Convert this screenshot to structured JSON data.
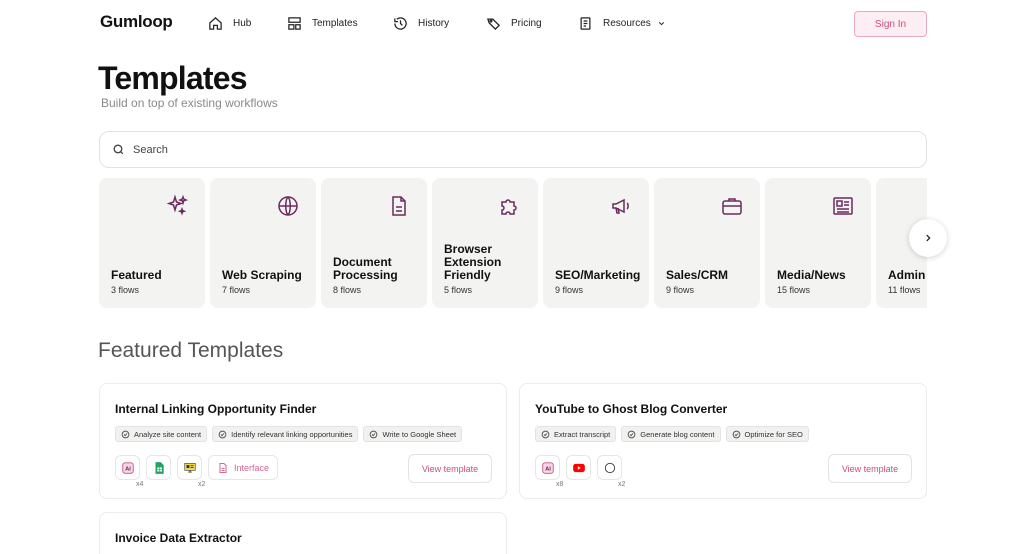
{
  "header": {
    "logo": "Gumloop",
    "nav": [
      {
        "label": "Hub",
        "icon": "home-icon"
      },
      {
        "label": "Templates",
        "icon": "layout-icon"
      },
      {
        "label": "History",
        "icon": "history-icon"
      },
      {
        "label": "Pricing",
        "icon": "tag-icon"
      },
      {
        "label": "Resources",
        "icon": "book-icon"
      }
    ],
    "signin": "Sign In"
  },
  "page": {
    "title": "Templates",
    "subtitle": "Build on top of existing workflows"
  },
  "search": {
    "placeholder": "Search"
  },
  "categories": [
    {
      "name": "Featured",
      "count": "3 flows",
      "icon": "sparkles-icon"
    },
    {
      "name": "Web Scraping",
      "count": "7 flows",
      "icon": "globe-icon"
    },
    {
      "name": "Document Processing",
      "count": "8 flows",
      "icon": "document-icon"
    },
    {
      "name": "Browser Extension Friendly",
      "count": "5 flows",
      "icon": "puzzle-icon"
    },
    {
      "name": "SEO/Marketing",
      "count": "9 flows",
      "icon": "megaphone-icon"
    },
    {
      "name": "Sales/CRM",
      "count": "9 flows",
      "icon": "briefcase-icon"
    },
    {
      "name": "Media/News",
      "count": "15 flows",
      "icon": "newspaper-icon"
    },
    {
      "name": "Admin",
      "count": "11 flows",
      "icon": "admin-icon"
    }
  ],
  "featured": {
    "title": "Featured Templates",
    "cards": [
      {
        "title": "Internal Linking Opportunity Finder",
        "tags": [
          "Analyze site content",
          "Identify relevant linking opportunities",
          "Write to Google Sheet"
        ],
        "nodes": [
          {
            "icon": "ai-icon",
            "count": "x4"
          },
          {
            "icon": "google-sheets-icon",
            "count": ""
          },
          {
            "icon": "scraper-icon",
            "count": "x2"
          }
        ],
        "interface_label": "Interface",
        "button": "View template"
      },
      {
        "title": "YouTube to Ghost Blog Converter",
        "tags": [
          "Extract transcript",
          "Generate blog content",
          "Optimize for SEO"
        ],
        "nodes": [
          {
            "icon": "ai-icon",
            "count": "x8"
          },
          {
            "icon": "youtube-icon",
            "count": ""
          },
          {
            "icon": "ghost-icon",
            "count": "x2"
          }
        ],
        "button": "View template"
      },
      {
        "title": "Invoice Data Extractor"
      }
    ]
  },
  "colors": {
    "accent": "#c94f7c",
    "accent_bg": "#fdeef3",
    "icon_purple": "#6b2a5e",
    "card_bg": "#f3f3f2"
  }
}
